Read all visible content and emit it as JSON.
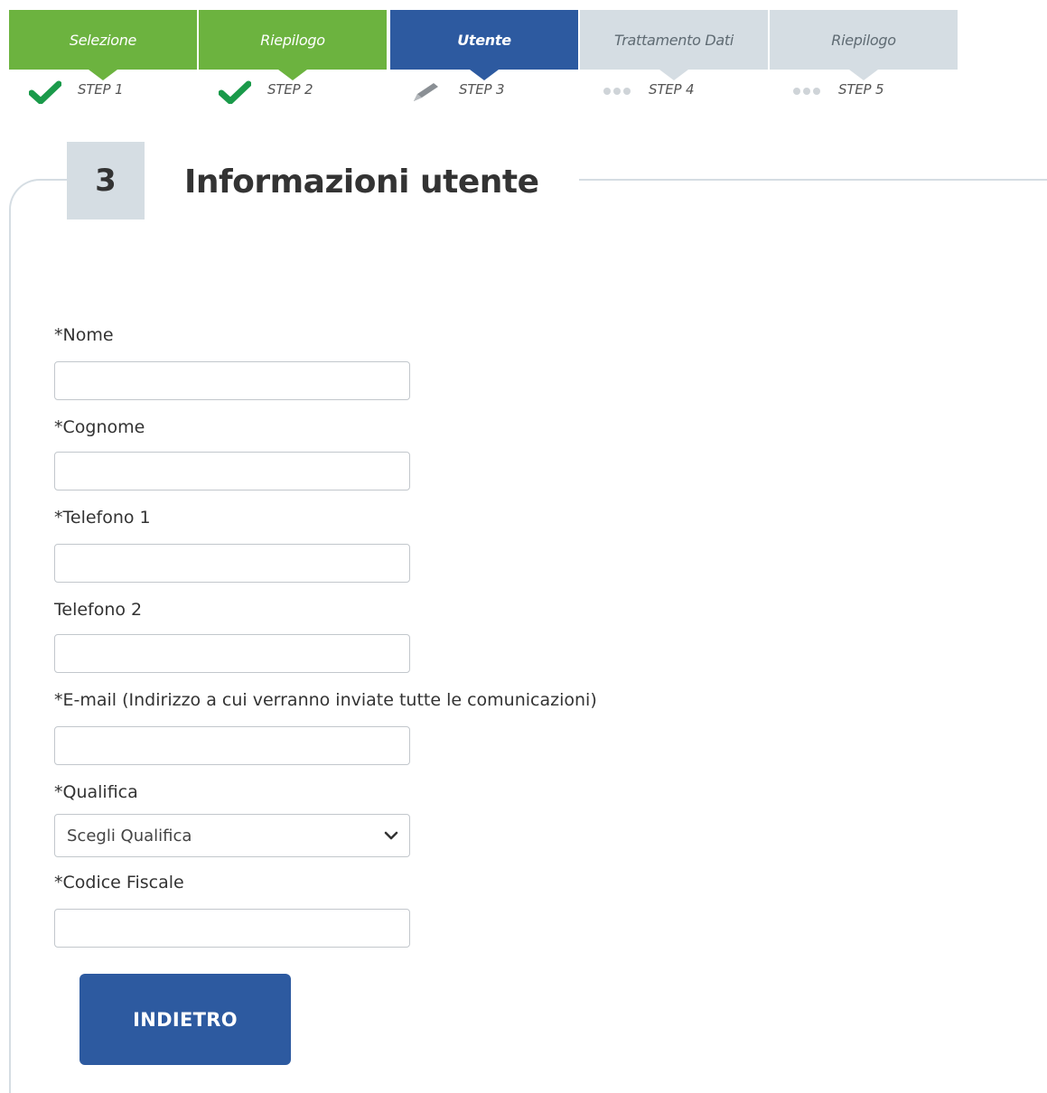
{
  "stepper": {
    "steps": [
      {
        "label": "Selezione",
        "step": "STEP 1",
        "state": "done",
        "icon": "check-icon"
      },
      {
        "label": "Riepilogo",
        "step": "STEP 2",
        "state": "done",
        "icon": "check-icon"
      },
      {
        "label": "Utente",
        "step": "STEP 3",
        "state": "active",
        "icon": "pencil-icon"
      },
      {
        "label": "Trattamento Dati",
        "step": "STEP 4",
        "state": "todo",
        "icon": "dots-icon"
      },
      {
        "label": "Riepilogo",
        "step": "STEP 5",
        "state": "todo",
        "icon": "dots-icon"
      }
    ]
  },
  "section": {
    "number": "3",
    "title": "Informazioni utente"
  },
  "form": {
    "nome_label": "*Nome",
    "nome_value": "",
    "cognome_label": "*Cognome",
    "cognome_value": "",
    "telefono1_label": "*Telefono 1",
    "telefono1_value": "",
    "telefono2_label": "Telefono 2",
    "telefono2_value": "",
    "email_label": "*E-mail (Indirizzo a cui verranno inviate tutte le comunicazioni)",
    "email_value": "",
    "qualifica_label": "*Qualifica",
    "qualifica_selected": "Scegli Qualifica",
    "codice_fiscale_label": "*Codice Fiscale",
    "codice_fiscale_value": ""
  },
  "actions": {
    "back_label": "INDIETRO"
  },
  "colors": {
    "done": "#6cb33f",
    "active": "#2d5aa0",
    "todo": "#d5dde3"
  }
}
